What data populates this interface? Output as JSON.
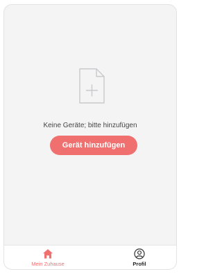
{
  "empty_state": {
    "icon": "add-file-icon",
    "message": "Keine Geräte; bitte hinzufügen",
    "button_label": "Gerät hinzufügen"
  },
  "bottom_nav": {
    "items": [
      {
        "label": "Mein Zuhause",
        "icon": "home-icon",
        "active": true
      },
      {
        "label": "Profil",
        "icon": "profile-icon",
        "active": false
      }
    ]
  },
  "colors": {
    "accent": "#f07070",
    "background": "#f4f4f5",
    "nav_background": "#ffffff"
  }
}
